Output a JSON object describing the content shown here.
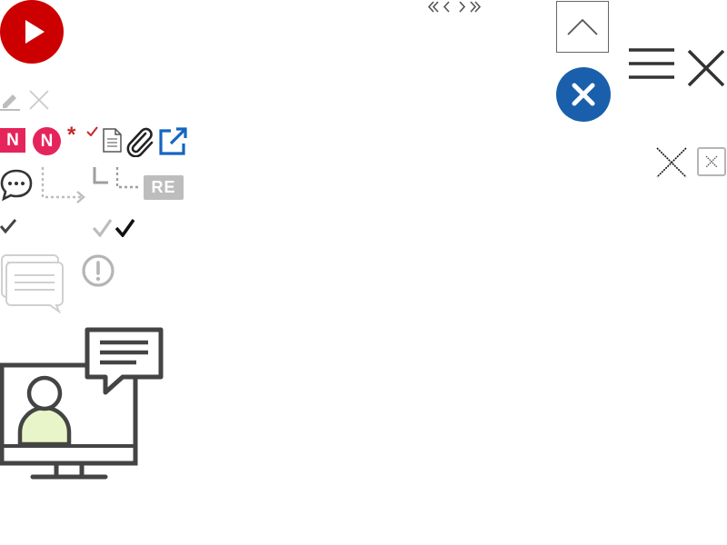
{
  "colors": {
    "play_red": "#cc0000",
    "badge_pink": "#e5245c",
    "required_red": "#c62828",
    "link_blue": "#1565c0",
    "close_blue": "#1a5fab",
    "icon_gray": "#bdbdbd",
    "dark": "#333333",
    "person_fill": "#e8f5c8"
  },
  "badges": {
    "new_square": "N",
    "new_circle": "N",
    "required_mark": "*",
    "reply": "RE"
  },
  "icons": [
    "play-icon",
    "pagination-arrows-icon",
    "chevron-up-icon",
    "close-circle-icon",
    "hamburger-menu-icon",
    "close-icon",
    "pencil-icon",
    "delete-x-icon",
    "check-icon",
    "document-icon",
    "paperclip-icon",
    "external-link-icon",
    "chat-bubble-icon",
    "dotted-reply-arrow-icon",
    "reply-corner-icon",
    "dotted-reply-branch-icon",
    "dotted-close-icon",
    "close-box-icon",
    "checkmark-icon",
    "checkmark-gray-icon",
    "checkmark-black-icon",
    "comments-icon",
    "alert-circle-icon",
    "online-consultation-icon"
  ]
}
